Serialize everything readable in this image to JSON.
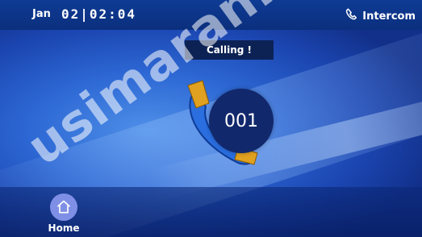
{
  "status_bar": {
    "month": "Jan",
    "time": "02|02:04",
    "intercom_label": "Intercom",
    "intercom_icon": "phone-icon"
  },
  "call": {
    "status": "Calling !",
    "number": "001",
    "handset_icon": "handset-icon"
  },
  "bottom_bar": {
    "home_label": "Home",
    "home_icon": "home-icon"
  },
  "watermark": {
    "text": "usimaran.c"
  },
  "colors": {
    "background": "#2d68d4",
    "top_bar": "#0e3b95",
    "calling_box": "#0c2255",
    "number_circle": "#12286c",
    "handset_accent": "#e0a020",
    "home_circle": "#7f8fe6"
  }
}
